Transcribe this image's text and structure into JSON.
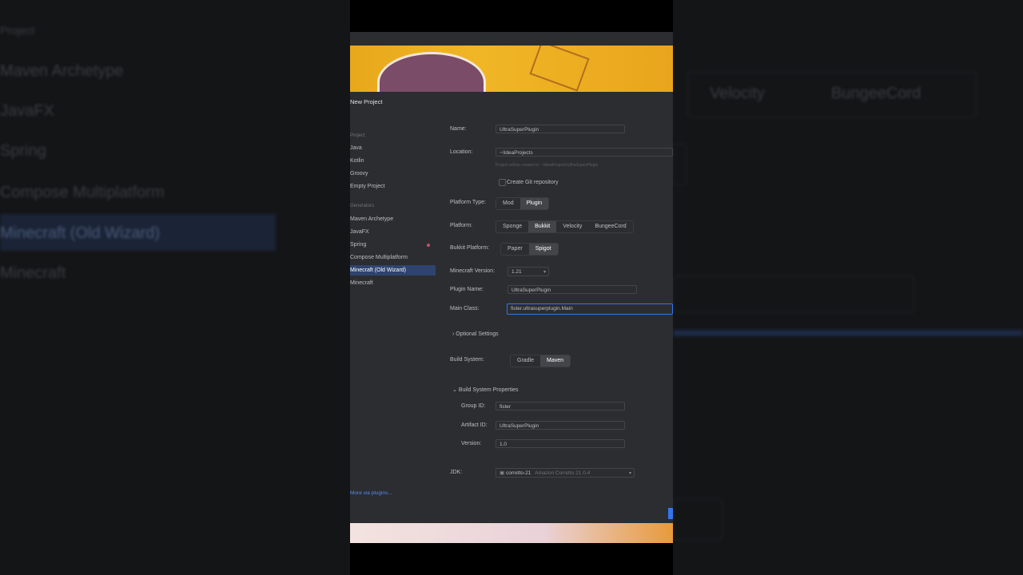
{
  "background": {
    "left_items": [
      "Maven Archetype",
      "JavaFX",
      "Spring",
      "Compose Multiplatform",
      "Minecraft (Old Wizard)",
      "Minecraft"
    ],
    "right_items": [
      "Velocity",
      "BungeeCord"
    ]
  },
  "dialog": {
    "title": "New Project",
    "sidebar": {
      "section1": "Project",
      "items1": [
        "Java",
        "Kotlin",
        "Groovy",
        "Empty Project"
      ],
      "section2": "Generators",
      "items2": [
        "Maven Archetype",
        "JavaFX",
        "Spring",
        "Compose Multiplatform",
        "Minecraft (Old Wizard)",
        "Minecraft"
      ],
      "selected": "Minecraft (Old Wizard)",
      "more_plugins": "More via plugins..."
    },
    "form": {
      "name_label": "Name:",
      "name_value": "UltraSuperPlugin",
      "location_label": "Location:",
      "location_value": "~\\IdeaProjects",
      "location_hint": "Project will be created in: ~\\IdeaProjects\\UltraSuperPlugin",
      "git_label": "Create Git repository",
      "platform_type_label": "Platform Type:",
      "platform_type_options": [
        "Mod",
        "Plugin"
      ],
      "platform_type_selected": "Plugin",
      "platform_label": "Platform:",
      "platform_options": [
        "Sponge",
        "Bukkit",
        "Velocity",
        "BungeeCord"
      ],
      "platform_selected": "Bukkit",
      "bukkit_platform_label": "Bukkit Platform:",
      "bukkit_platform_options": [
        "Paper",
        "Spigot"
      ],
      "bukkit_platform_selected": "Spigot",
      "mc_version_label": "Minecraft Version:",
      "mc_version_value": "1.21",
      "plugin_name_label": "Plugin Name:",
      "plugin_name_value": "UltraSuperPlugin",
      "main_class_label": "Main Class:",
      "main_class_value": "fister.ultrasuperplugin.Main",
      "optional_settings": "Optional Settings",
      "build_system_label": "Build System:",
      "build_system_options": [
        "Gradle",
        "Maven"
      ],
      "build_system_selected": "Maven",
      "build_props": "Build System Properties",
      "group_id_label": "Group ID:",
      "group_id_value": "fister",
      "artifact_id_label": "Artifact ID:",
      "artifact_id_value": "UltraSuperPlugin",
      "version_label": "Version:",
      "version_value": "1.0",
      "jdk_label": "JDK:",
      "jdk_value": "corretto-21",
      "jdk_detail": "Amazon Corretto 21.0.4"
    }
  }
}
